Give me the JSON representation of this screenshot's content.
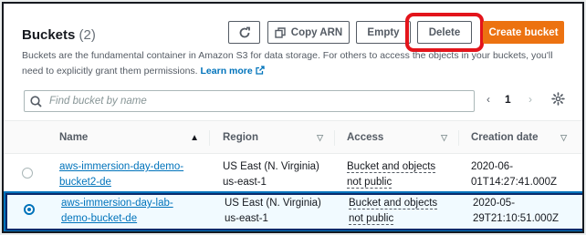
{
  "header": {
    "title": "Buckets",
    "count": "(2)",
    "description": "Buckets are the fundamental container in Amazon S3 for data storage. For others to access the objects in your buckets, you'll need to explicitly grant them permissions.",
    "learn_more": "Learn more"
  },
  "toolbar": {
    "refresh_icon": "refresh-icon",
    "copy_arn_label": "Copy ARN",
    "copy_icon": "copy-icon",
    "empty_label": "Empty",
    "delete_label": "Delete",
    "create_label": "Create bucket"
  },
  "search": {
    "placeholder": "Find bucket by name",
    "value": ""
  },
  "pagination": {
    "prev": "‹",
    "page": "1",
    "next": "›"
  },
  "table": {
    "columns": [
      "Name",
      "Region",
      "Access",
      "Creation date"
    ],
    "rows": [
      {
        "name": "aws-immersion-day-demo-bucket2-de",
        "region": "US East (N. Virginia) us-east-1",
        "access": "Bucket and objects not public",
        "created": "2020-06-01T14:27:41.000Z",
        "selected": false
      },
      {
        "name": "aws-immersion-day-lab-demo-bucket-de",
        "region": "US East (N. Virginia) us-east-1",
        "access": "Bucket and objects not public",
        "created": "2020-05-29T21:10:51.000Z",
        "selected": true
      }
    ]
  },
  "colors": {
    "accent": "#0073bb",
    "primary_button": "#ec7211",
    "annotation": "#e3141b"
  }
}
